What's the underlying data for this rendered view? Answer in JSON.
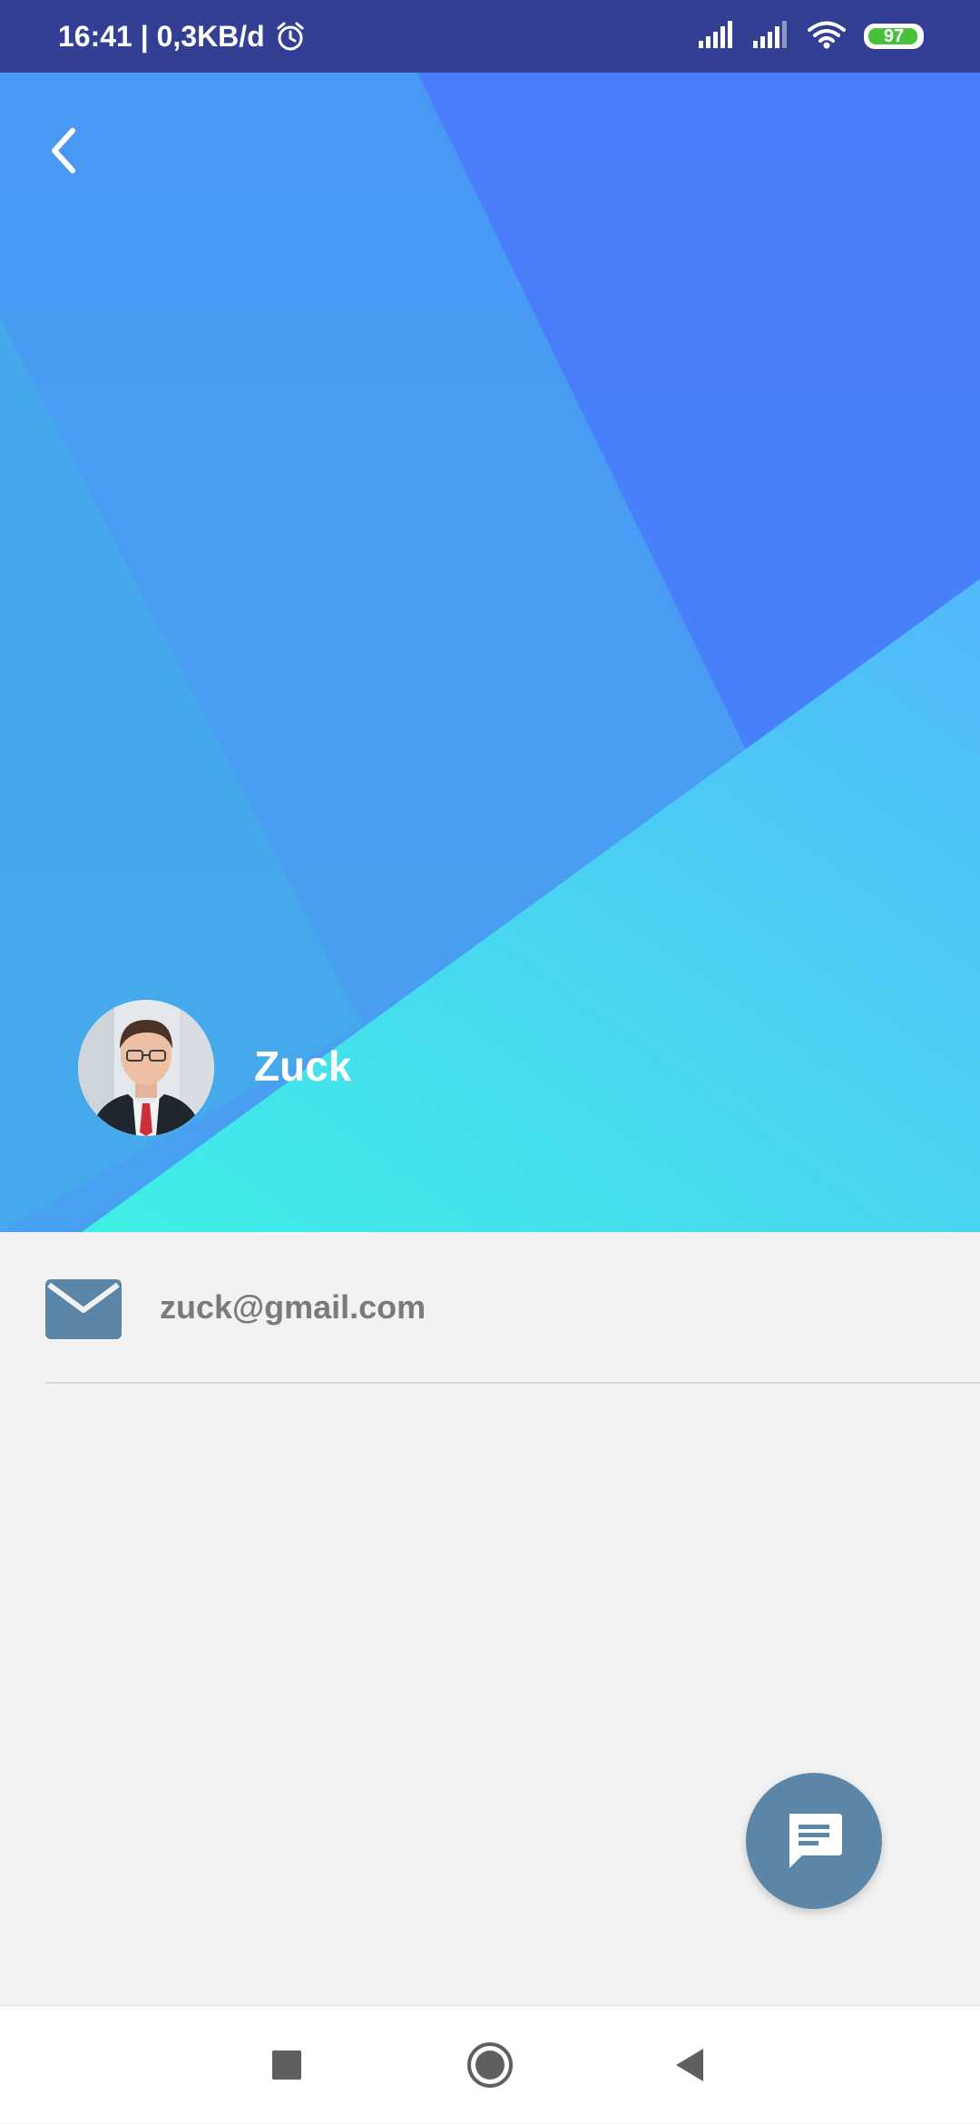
{
  "status_bar": {
    "time_and_speed": "16:41 | 0,3KB/d",
    "battery_level": "97",
    "battery_fraction": 0.97,
    "icons": [
      "alarm-icon",
      "signal-icon",
      "signal-icon",
      "wifi-icon",
      "battery-icon"
    ]
  },
  "header": {
    "back_icon": "chevron-left-icon",
    "colors": {
      "base": "#4a9cf0",
      "dark_band": "#4678fb",
      "light_band": "#4dd6f0"
    }
  },
  "profile": {
    "name": "Zuck",
    "avatar": "profile-photo"
  },
  "contact": {
    "email_icon": "mail-icon",
    "email": "zuck@gmail.com",
    "icon_color": "#5b86a8"
  },
  "fab": {
    "icon": "message-icon",
    "color": "#5b86a8"
  },
  "nav_bar": {
    "buttons": [
      "recents-square-icon",
      "home-circle-icon",
      "back-triangle-icon"
    ]
  }
}
